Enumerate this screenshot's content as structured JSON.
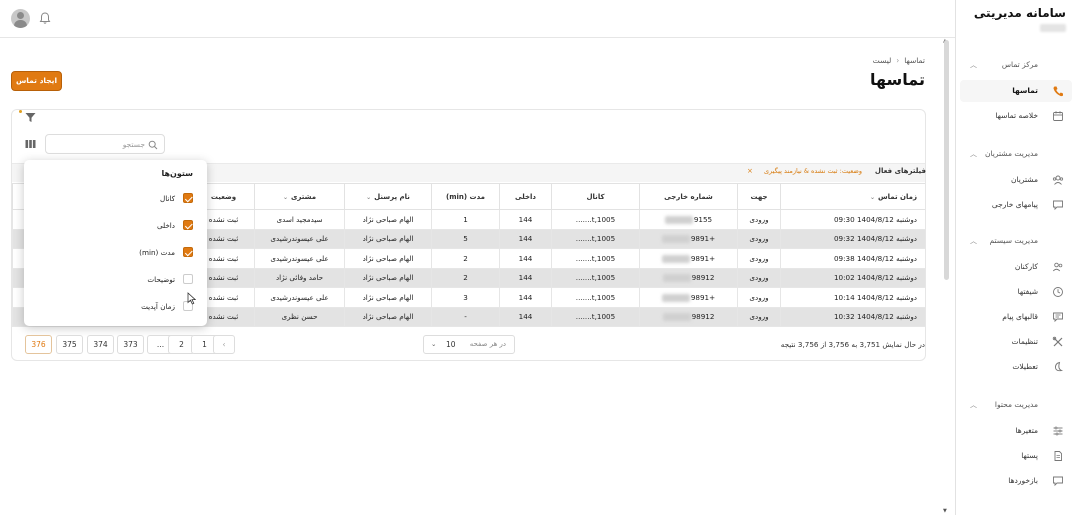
{
  "app": {
    "title": "سامانه مدیریتی"
  },
  "header": {
    "avatar_icon": "user-avatar-icon",
    "bell_icon": "bell-icon"
  },
  "sidebar": {
    "sections": [
      {
        "title": "مرکز تماس",
        "items": [
          {
            "label": "تماسها",
            "icon": "phone-icon",
            "active": true
          },
          {
            "label": "خلاصه تماسها",
            "icon": "calendar-icon"
          }
        ]
      },
      {
        "title": "مدیریت مشتریان",
        "items": [
          {
            "label": "مشتریان",
            "icon": "users-icon"
          },
          {
            "label": "پیامهای خارجی",
            "icon": "message-icon"
          }
        ]
      },
      {
        "title": "مدیریت سیستم",
        "items": [
          {
            "label": "کارکنان",
            "icon": "staff-icon"
          },
          {
            "label": "شیفتها",
            "icon": "clock-icon"
          },
          {
            "label": "قالبهای پیام",
            "icon": "template-icon"
          },
          {
            "label": "تنظیمات",
            "icon": "tools-icon"
          },
          {
            "label": "تعطیلات",
            "icon": "moon-icon"
          }
        ]
      },
      {
        "title": "مدیریت محتوا",
        "items": [
          {
            "label": "متغیرها",
            "icon": "sliders-icon"
          },
          {
            "label": "پستها",
            "icon": "document-icon"
          },
          {
            "label": "بازخوردها",
            "icon": "feedback-icon"
          }
        ]
      }
    ]
  },
  "breadcrumb": {
    "items": [
      "تماسها",
      "لیست"
    ]
  },
  "page": {
    "title": "تماسها",
    "create_button": "ایجاد تماس"
  },
  "toolbar": {
    "search_placeholder": "جستجو"
  },
  "filters": {
    "label": "فیلترهای فعال",
    "chip": "وضعیت: ثبت نشده & نیازمند پیگیری",
    "chip_close": "×"
  },
  "table": {
    "headers": [
      "زمان تماس",
      "جهت",
      "شماره خارجی",
      "کانال",
      "داخلی",
      "مدت (min)",
      "نام پرسنل",
      "مشتری",
      "وضعیت"
    ],
    "rows": [
      [
        "دوشنبه 1404/8/12 09:30",
        "ورودی",
        "9155",
        "1005,t.......",
        "144",
        "1",
        "الهام صباحی نژاد",
        "سیدمجید اسدی",
        "ثبت نشده"
      ],
      [
        "دوشنبه 1404/8/12 09:32",
        "ورودی",
        "+9891",
        "1005,t.......",
        "144",
        "5",
        "الهام صباحی نژاد",
        "علی عیسوندرشیدی",
        "ثبت نشده"
      ],
      [
        "دوشنبه 1404/8/12 09:38",
        "ورودی",
        "+9891",
        "1005,t.......",
        "144",
        "2",
        "الهام صباحی نژاد",
        "علی عیسوندرشیدی",
        "ثبت نشده"
      ],
      [
        "دوشنبه 1404/8/12 10:02",
        "ورودی",
        "98912",
        "1005,t.......",
        "144",
        "2",
        "الهام صباحی نژاد",
        "حامد وفائی نژاد",
        "ثبت نشده"
      ],
      [
        "دوشنبه 1404/8/12 10:14",
        "ورودی",
        "+9891",
        "1005,t.......",
        "144",
        "3",
        "الهام صباحی نژاد",
        "علی عیسوندرشیدی",
        "ثبت نشده"
      ],
      [
        "دوشنبه 1404/8/12 10:32",
        "ورودی",
        "98912",
        "1005,t.......",
        "144",
        "-",
        "الهام صباحی نژاد",
        "حسن نظری",
        "ثبت نشده"
      ]
    ]
  },
  "columns_popup": {
    "title": "ستون‌ها",
    "options": [
      {
        "label": "کانال",
        "checked": true
      },
      {
        "label": "داخلی",
        "checked": true
      },
      {
        "label": "مدت (min)",
        "checked": true
      },
      {
        "label": "توضیحات",
        "checked": false
      },
      {
        "label": "زمان آپدیت",
        "checked": false
      }
    ]
  },
  "pagination": {
    "pages": [
      "376",
      "375",
      "374",
      "373",
      "...",
      "2",
      "1"
    ],
    "prev": "‹",
    "active_page": "376",
    "page_size_label": "در هر صفحه",
    "page_size_value": "10",
    "summary": "در حال نمایش 3,751 به 3,756 از 3,756 نتیجه"
  },
  "colors": {
    "accent": "#e07a12",
    "filter_text": "#d87c10"
  }
}
